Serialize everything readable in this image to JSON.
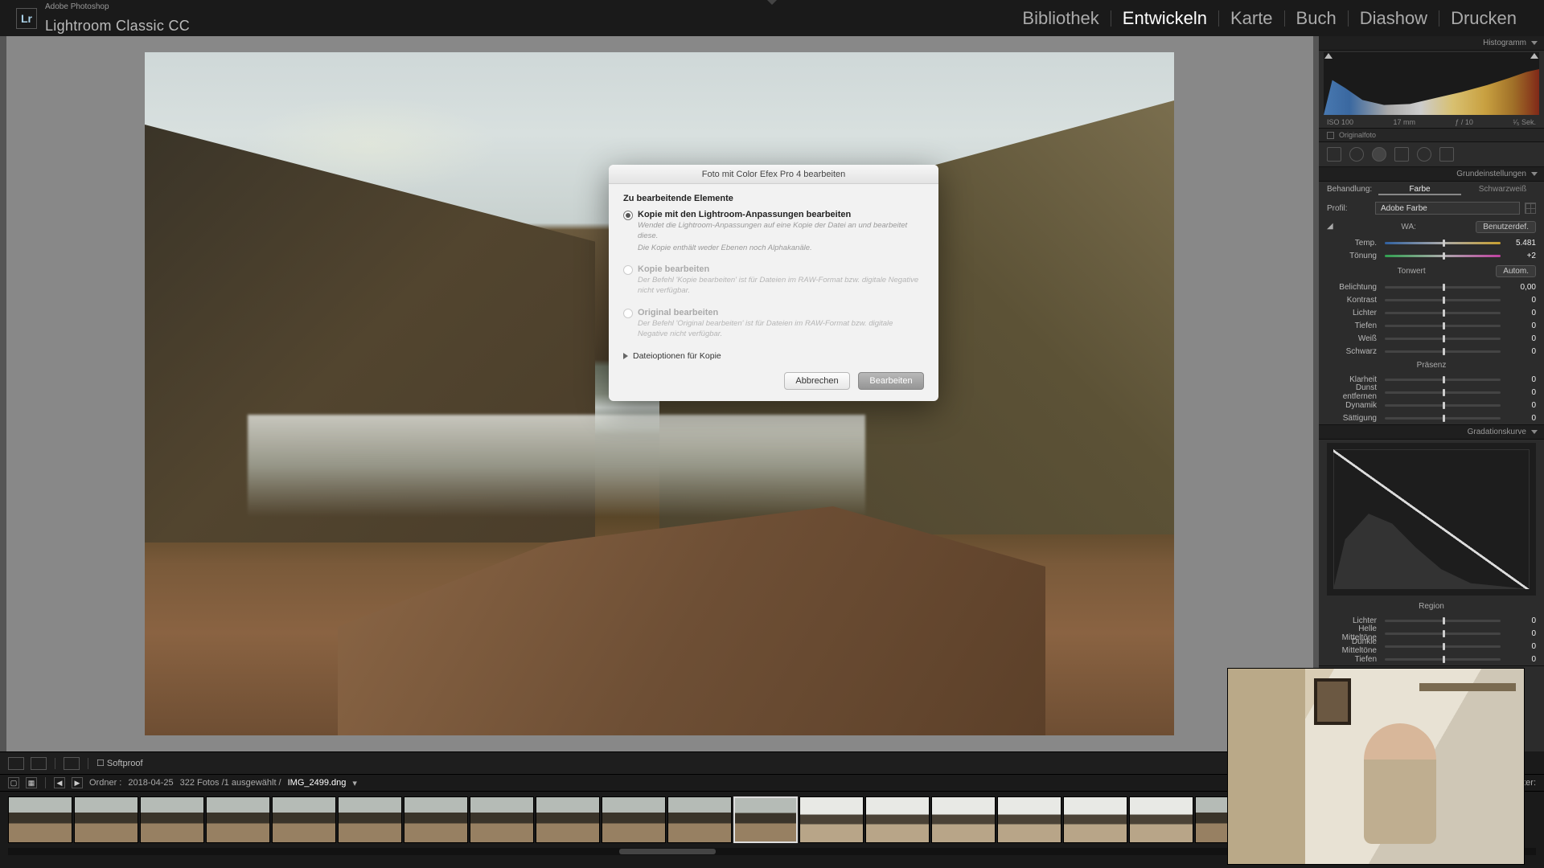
{
  "app": {
    "suite": "Adobe Photoshop",
    "name": "Lightroom Classic CC",
    "logo": "Lr"
  },
  "modules": {
    "items": [
      "Bibliothek",
      "Entwickeln",
      "Karte",
      "Buch",
      "Diashow",
      "Drucken"
    ],
    "active": "Entwickeln"
  },
  "dialog": {
    "title": "Foto mit Color Efex Pro 4 bearbeiten",
    "section": "Zu bearbeitende Elemente",
    "opt1": {
      "label": "Kopie mit den Lightroom-Anpassungen bearbeiten",
      "desc1": "Wendet die Lightroom-Anpassungen auf eine Kopie der Datei an und bearbeitet diese.",
      "desc2": "Die Kopie enthält weder Ebenen noch Alphakanäle."
    },
    "opt2": {
      "label": "Kopie bearbeiten",
      "desc": "Der Befehl 'Kopie bearbeiten' ist für Dateien im RAW-Format bzw. digitale Negative nicht verfügbar."
    },
    "opt3": {
      "label": "Original bearbeiten",
      "desc": "Der Befehl 'Original bearbeiten' ist für Dateien im RAW-Format bzw. digitale Negative nicht verfügbar."
    },
    "disclosure": "Dateioptionen für Kopie",
    "cancel": "Abbrechen",
    "ok": "Bearbeiten"
  },
  "panels": {
    "histogram_title": "Histogramm",
    "exif": {
      "iso": "ISO 100",
      "lens": "17 mm",
      "ap": "ƒ / 10",
      "sh": "¹⁄₅ Sek."
    },
    "originalfoto": "Originalfoto",
    "basic": {
      "title": "Grundeinstellungen",
      "treatment_label": "Behandlung:",
      "color": "Farbe",
      "bw": "Schwarzweiß",
      "profile_label": "Profil:",
      "profile": "Adobe Farbe",
      "wb_label": "WA:",
      "wb_value": "Benutzerdef.",
      "temp_label": "Temp.",
      "temp_value": "5.481",
      "tint_label": "Tönung",
      "tint_value": "+2",
      "tone_label": "Tonwert",
      "auto": "Autom.",
      "exposure_label": "Belichtung",
      "exposure_value": "0,00",
      "contrast_label": "Kontrast",
      "contrast_value": "0",
      "highlights_label": "Lichter",
      "highlights_value": "0",
      "shadows_label": "Tiefen",
      "shadows_value": "0",
      "whites_label": "Weiß",
      "whites_value": "0",
      "blacks_label": "Schwarz",
      "blacks_value": "0",
      "presence_label": "Präsenz",
      "clarity_label": "Klarheit",
      "clarity_value": "0",
      "dehaze_label": "Dunst entfernen",
      "dehaze_value": "0",
      "vibrance_label": "Dynamik",
      "vibrance_value": "0",
      "saturation_label": "Sättigung",
      "saturation_value": "0"
    },
    "curve_title": "Gradationskurve",
    "region": {
      "title": "Region",
      "lights": "Lichter",
      "lights_v": "0",
      "hmid": "Helle Mitteltöne",
      "hmid_v": "0",
      "dmid": "Dunkle Mitteltöne",
      "dmid_v": "0",
      "darks": "Tiefen",
      "darks_v": "0"
    }
  },
  "underbar": {
    "softproof": "Softproof"
  },
  "filmstrip": {
    "folder_label": "Ordner :",
    "folder": "2018-04-25",
    "count": "322 Fotos /1 ausgewählt /",
    "filename": "IMG_2499.dng",
    "filter": "Filter:"
  }
}
